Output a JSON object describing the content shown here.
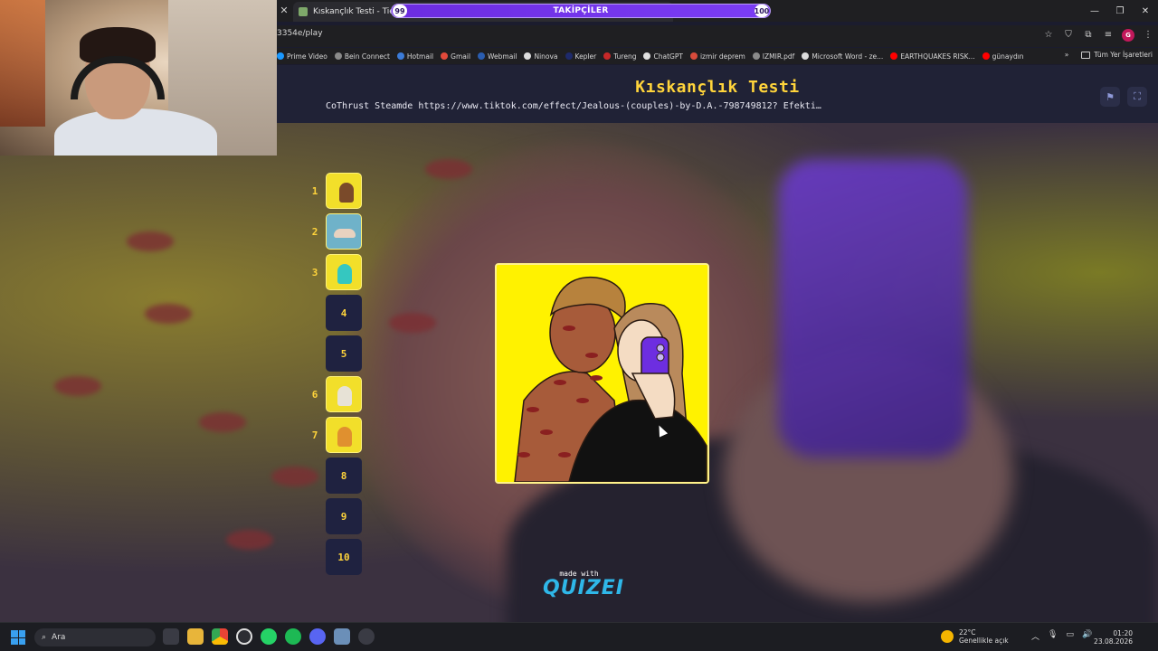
{
  "browser": {
    "tab_title": "Kıskançlık Testi - Tier List, K",
    "url": "3354e/play",
    "bookmarks": [
      "Prime Video",
      "Bein Connect",
      "Hotmail",
      "Gmail",
      "Webmail",
      "Ninova",
      "Kepler",
      "Tureng",
      "ChatGPT",
      "izmir deprem",
      "IZMIR.pdf",
      "Microsoft Word - ze...",
      "EARTHQUAKES RISK...",
      "günaydın"
    ],
    "bookmarks_folder": "Tüm Yer İşaretleri",
    "profile_initial": "G"
  },
  "followers_goal": {
    "label": "TAKİPÇİLER",
    "current": "99",
    "target": "100",
    "progress_fraction": 0.99
  },
  "quiz": {
    "title": "Kıskançlık Testi",
    "subtitle": "CoThrust Steamde https://www.tiktok.com/effect/Jealous-(couples)-by-D.A.-798749812? Efekti…",
    "ranks": [
      {
        "num": "1",
        "filled": true
      },
      {
        "num": "2",
        "filled": true
      },
      {
        "num": "3",
        "filled": true
      },
      {
        "num": "4",
        "filled": false,
        "slot_label": "4"
      },
      {
        "num": "5",
        "filled": false,
        "slot_label": "5"
      },
      {
        "num": "6",
        "filled": true
      },
      {
        "num": "7",
        "filled": true
      },
      {
        "num": "8",
        "filled": false,
        "slot_label": "8"
      },
      {
        "num": "9",
        "filled": false,
        "slot_label": "9"
      },
      {
        "num": "10",
        "filled": false,
        "slot_label": "10"
      }
    ],
    "made_with": "made with",
    "brand": "QUIZEI"
  },
  "taskbar": {
    "search_placeholder": "Ara",
    "weather_temp": "22°C",
    "weather_desc": "Genellikle açık",
    "time": "01:20",
    "date": "23.08.2026"
  },
  "colors": {
    "accent_yellow": "#ffd43b",
    "header_bg": "#202236",
    "slot_bg": "#1f2240",
    "brand_blue": "#2fb7e8",
    "follower_purple": "#6c2ce0"
  }
}
